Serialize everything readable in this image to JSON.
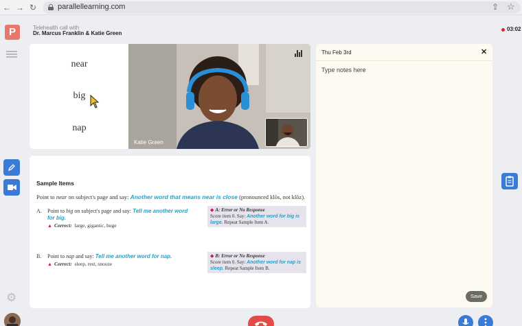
{
  "browser": {
    "url": "parallellearning.com",
    "back_icon": "←",
    "forward_icon": "→",
    "reload_icon": "↻",
    "share_icon": "⇪",
    "star_icon": "☆"
  },
  "app": {
    "logo_letter": "P",
    "brand_color": "#e8776e",
    "accent_color": "#3a7bd5"
  },
  "header": {
    "subtitle": "Telehealth call with",
    "participants": "Dr. Marcus Franklin & Katie Green",
    "timer": "03:02"
  },
  "stimulus": {
    "words": [
      "near",
      "big",
      "nap"
    ]
  },
  "video": {
    "participant_name": "Katie Green"
  },
  "notes": {
    "date": "Thu Feb 3rd",
    "close_label": "✕",
    "placeholder": "Type notes here",
    "save_label": "Save"
  },
  "instructions": {
    "title": "Sample Items",
    "intro_pre": "Point to ",
    "intro_word": "near",
    "intro_mid": " on subject's page and say: ",
    "intro_prompt": "Another word that means near is close",
    "intro_post": " (pronounced klōs, not klōz).",
    "items": [
      {
        "label": "A.",
        "pre": "Point to ",
        "word": "big",
        "mid": " on subject's page and say: ",
        "prompt": "Tell me another word for big.",
        "correct_label": "Correct:",
        "correct_answers": "large, gigantic, huge",
        "error_title": "A: Error or No Response",
        "error_pre": "Score item 0. Say: ",
        "error_prompt": "Another word for big is large.",
        "error_post": " Repeat Sample Item A."
      },
      {
        "label": "B.",
        "pre": "Point to ",
        "word": "nap",
        "mid": " and say: ",
        "prompt": "Tell me another word for nap.",
        "correct_label": "Correct:",
        "correct_answers": "sleep, rest, snooze",
        "error_title": "B: Error or No Response",
        "error_pre": "Score item 0. Say: ",
        "error_prompt": "Another word for nap is sleep.",
        "error_post": " Repeat Sample Item B."
      }
    ]
  }
}
